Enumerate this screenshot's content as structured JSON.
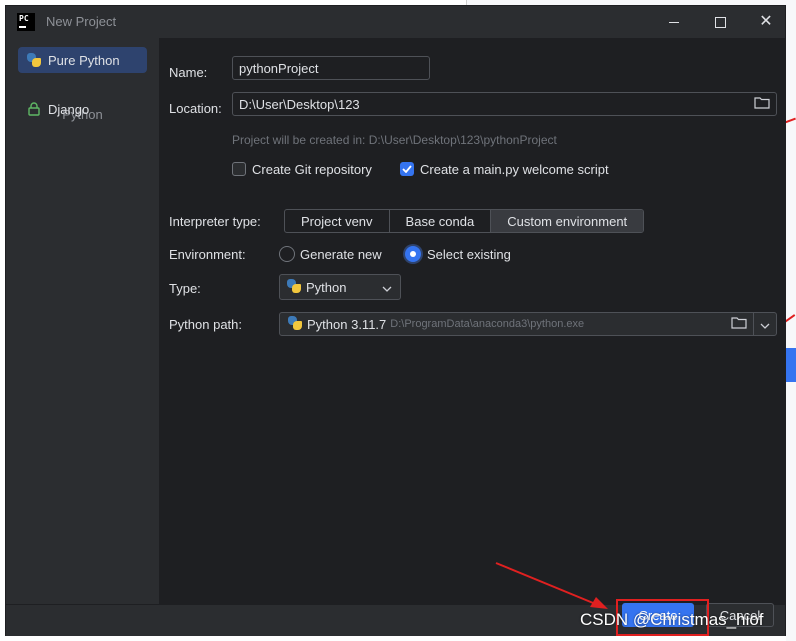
{
  "window": {
    "title": "New Project",
    "app_logo_text": "PC"
  },
  "sidebar": {
    "items": [
      {
        "label": "Pure Python",
        "icon": "python-icon",
        "selected": true
      },
      {
        "label": "Django",
        "icon": "django-icon",
        "selected": false
      }
    ],
    "group_label": "Python"
  },
  "form": {
    "name": {
      "label": "Name:",
      "value": "pythonProject"
    },
    "location": {
      "label": "Location:",
      "value": "D:\\User\\Desktop\\123"
    },
    "project_hint": "Project will be created in: D:\\User\\Desktop\\123\\pythonProject",
    "create_git": {
      "label": "Create Git repository",
      "checked": false
    },
    "create_main": {
      "label": "Create a main.py welcome script",
      "checked": true
    },
    "interpreter_type": {
      "label": "Interpreter type:",
      "options": [
        "Project venv",
        "Base conda",
        "Custom environment"
      ],
      "selected": "Custom environment"
    },
    "environment": {
      "label": "Environment:",
      "options": [
        "Generate new",
        "Select existing"
      ],
      "selected": "Select existing"
    },
    "type": {
      "label": "Type:",
      "value": "Python"
    },
    "python_path": {
      "label": "Python path:",
      "version": "Python 3.11.7",
      "path": "D:\\ProgramData\\anaconda3\\python.exe"
    }
  },
  "footer": {
    "create_label": "Create",
    "cancel_label": "Cancel"
  },
  "watermark": "CSDN @Christmas_hiof",
  "colors": {
    "accent": "#3574f0",
    "dialog_bg": "#2b2d30",
    "content_bg": "#1e1f22",
    "annotation_red": "#e02020"
  }
}
